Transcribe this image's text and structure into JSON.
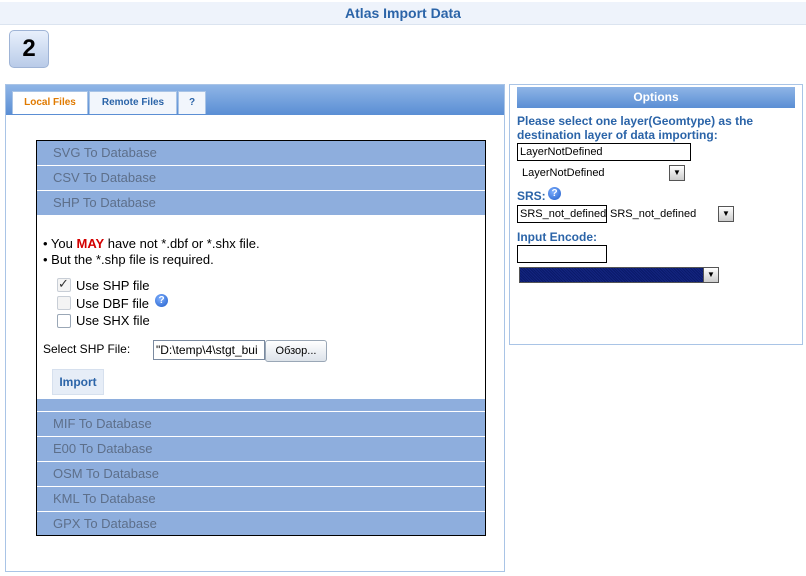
{
  "page": {
    "title": "Atlas Import Data",
    "step": "2"
  },
  "tabs": [
    {
      "label": "Local Files",
      "active": true
    },
    {
      "label": "Remote Files",
      "active": false
    },
    {
      "label": "?",
      "active": false
    }
  ],
  "accordion_top": [
    "SVG To Database",
    "CSV To Database",
    "SHP To Database"
  ],
  "shp_panel": {
    "note_prefix": "• You ",
    "note_may": "MAY",
    "note_suffix": " have not *.dbf or *.shx file.",
    "note2": "• But the *.shp file is required.",
    "options": [
      {
        "label": "Use SHP file",
        "checked": true,
        "disabled": true
      },
      {
        "label": "Use DBF file",
        "checked": false,
        "disabled": true
      },
      {
        "label": "Use SHX file",
        "checked": false,
        "disabled": false
      }
    ],
    "select_label": "Select SHP File:",
    "file_value": "\"D:\\temp\\4\\stgt_bui",
    "browse_label": "Обзор...",
    "import_label": "Import"
  },
  "accordion_bottom": [
    "MIF To Database",
    "E00 To Database",
    "OSM To Database",
    "KML To Database",
    "GPX To Database"
  ],
  "options": {
    "header": "Options",
    "layer_prompt": "Please select one layer(Geomtype) as the destination layer of data importing:",
    "layer_input": "LayerNotDefined",
    "layer_select": "LayerNotDefined",
    "srs_label": "SRS:",
    "srs_input": "SRS_not_defined",
    "srs_select": "SRS_not_defined",
    "encode_label": "Input Encode:",
    "encode_input": "",
    "encode_select": ""
  },
  "colors": {
    "accent": "#2b64a8",
    "may": "#d40000",
    "tab_active": "#e07a00"
  }
}
